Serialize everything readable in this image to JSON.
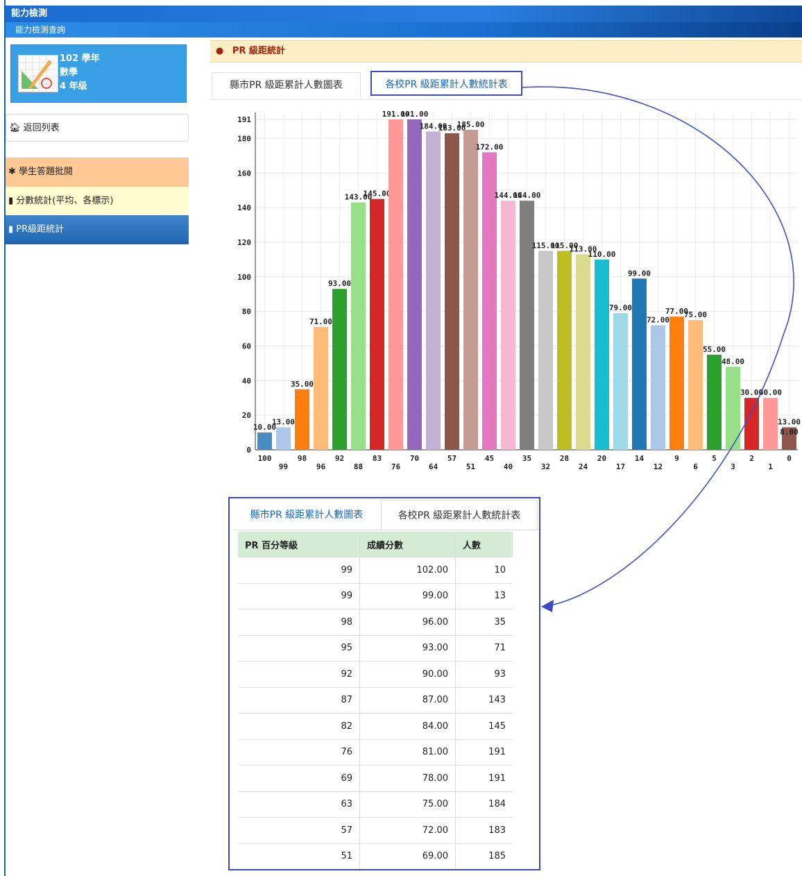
{
  "header": {
    "title": "能力檢測",
    "subtitle": "能力檢測查詢"
  },
  "info_card": {
    "year": "102 學年",
    "subject": "數學",
    "grade": "4 年级"
  },
  "menu": {
    "back": "返回列表",
    "grading": "學生答題批閱",
    "score_stats": "分數統計(平均、各標示)",
    "pr_stats": "PR級距統計"
  },
  "section_title": "PR 級距統計",
  "tabs": {
    "chart_tab": "縣市PR 級距累計人數圖表",
    "table_tab": "各校PR 級距累計人數統計表"
  },
  "table": {
    "headers": [
      "PR 百分等級",
      "成績分數",
      "人數"
    ],
    "rows": [
      [
        "99",
        "102.00",
        "10"
      ],
      [
        "99",
        "99.00",
        "13"
      ],
      [
        "98",
        "96.00",
        "35"
      ],
      [
        "95",
        "93.00",
        "71"
      ],
      [
        "92",
        "90.00",
        "93"
      ],
      [
        "87",
        "87.00",
        "143"
      ],
      [
        "82",
        "84.00",
        "145"
      ],
      [
        "76",
        "81.00",
        "191"
      ],
      [
        "69",
        "78.00",
        "191"
      ],
      [
        "63",
        "75.00",
        "184"
      ],
      [
        "57",
        "72.00",
        "183"
      ],
      [
        "51",
        "69.00",
        "185"
      ]
    ]
  },
  "chart_data": {
    "type": "bar",
    "categories": [
      "100",
      "99",
      "98",
      "96",
      "92",
      "88",
      "83",
      "76",
      "70",
      "64",
      "57",
      "51",
      "45",
      "40",
      "35",
      "32",
      "28",
      "24",
      "20",
      "17",
      "14",
      "12",
      "9",
      "6",
      "5",
      "3",
      "2",
      "1",
      "0"
    ],
    "values": [
      10,
      13,
      35,
      71,
      93,
      143,
      145,
      191,
      191,
      184,
      183,
      185,
      172,
      144,
      144,
      115,
      115,
      113,
      110,
      79,
      99,
      72,
      77,
      75,
      55,
      48,
      30,
      30,
      13
    ],
    "extra_label": {
      "category": "0",
      "value": 8
    },
    "y_ticks": [
      0,
      20,
      40,
      60,
      80,
      100,
      120,
      140,
      160,
      180,
      191
    ],
    "ylim": [
      0,
      191
    ],
    "grid": true,
    "colors": [
      "#4a8cc4",
      "#aec7e8",
      "#ff7f0e",
      "#ffbb78",
      "#2ca02c",
      "#98df8a",
      "#d62728",
      "#ff9896",
      "#9467bd",
      "#c5b0d5",
      "#8c564b",
      "#c49c94",
      "#e377c2",
      "#f7b6d2",
      "#7f7f7f",
      "#c7c7c7",
      "#bcbd22",
      "#dbdb8d",
      "#17becf",
      "#9edae5",
      "#1f77b4",
      "#aec7e8",
      "#ff7f0e",
      "#ffbb78",
      "#2ca02c",
      "#98df8a",
      "#d62728",
      "#ff9896",
      "#8c564b"
    ]
  }
}
